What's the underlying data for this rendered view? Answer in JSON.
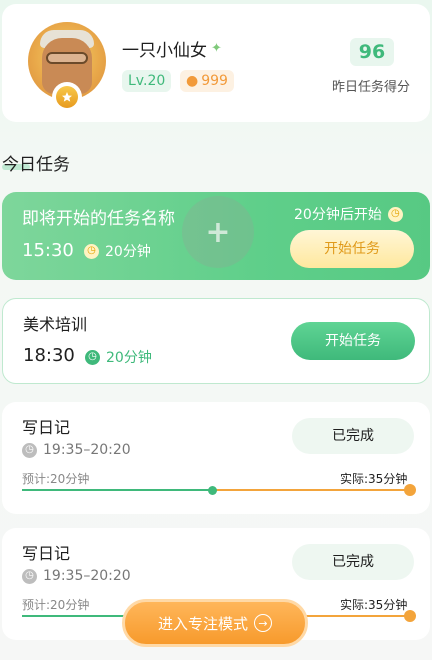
{
  "profile": {
    "username": "一只小仙女",
    "level": "Lv.20",
    "coins": "999",
    "yesterday_score": "96",
    "yesterday_score_label": "昨日任务得分"
  },
  "section": {
    "title": "今日任务"
  },
  "upcoming_task": {
    "name": "即将开始的任务名称",
    "start_time": "15:30",
    "duration": "20分钟",
    "starts_in": "20分钟后开始",
    "button": "开始任务"
  },
  "pending_task": {
    "name": "美术培训",
    "start_time": "18:30",
    "duration": "20分钟",
    "button": "开始任务"
  },
  "done_tasks": [
    {
      "name": "写日记",
      "range": "19:35–20:20",
      "status": "已完成",
      "estimated": "预计:20分钟",
      "actual": "实际:35分钟"
    },
    {
      "name": "写日记",
      "range": "19:35–20:20",
      "status": "已完成",
      "estimated": "预计:20分钟",
      "actual": "实际:35分钟"
    }
  ],
  "focus_button": "进入专注模式",
  "colors": {
    "primary_green": "#3fb97b",
    "accent_orange": "#f79a2c"
  },
  "icons": [
    "clock-icon",
    "coin-icon",
    "plus-icon",
    "arrow-right-circle-icon",
    "fairy-icon",
    "medal-badge-icon"
  ]
}
